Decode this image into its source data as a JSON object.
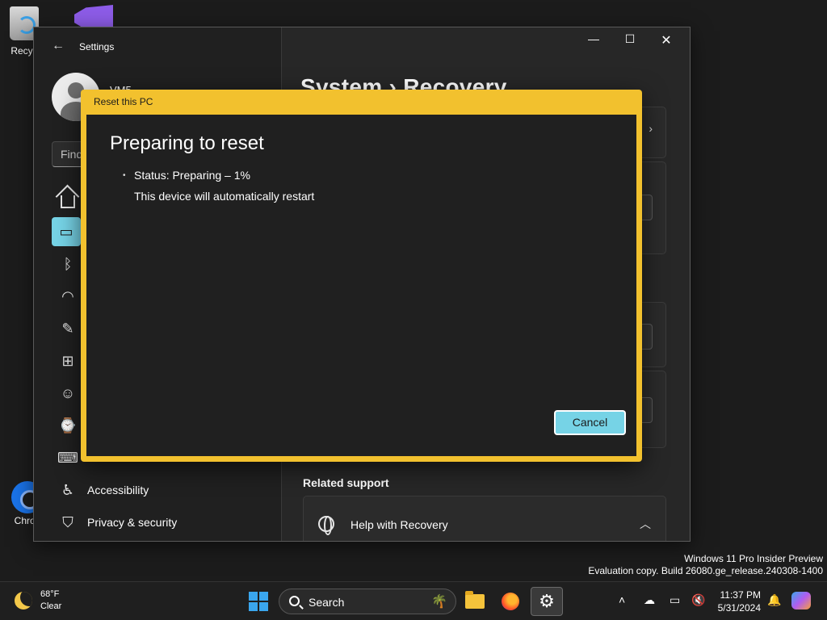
{
  "desktop": {
    "icons": [
      {
        "label": "Recyc"
      },
      {
        "label": "Chron"
      }
    ]
  },
  "settings": {
    "app_title": "Settings",
    "user_name": "VM5",
    "search_placeholder": "Find",
    "nav_items": [
      {
        "label": "Accessibility"
      },
      {
        "label": "Privacy & security"
      }
    ],
    "page_title": "System  ›  Recovery",
    "related_support": "Related support",
    "help_label": "Help with Recovery"
  },
  "dialog": {
    "title": "Reset this PC",
    "heading": "Preparing to reset",
    "status": "Status: Preparing – 1%",
    "restart_note": "This device will automatically restart",
    "cancel_label": "Cancel",
    "accent_color": "#f2c12e",
    "button_color": "#76d3e6"
  },
  "watermark": {
    "line1": "Windows 11 Pro Insider Preview",
    "line2": "Evaluation copy. Build 26080.ge_release.240308-1400"
  },
  "taskbar": {
    "weather_temp": "68°F",
    "weather_desc": "Clear",
    "search_label": "Search",
    "time": "11:37 PM",
    "date": "5/31/2024"
  }
}
